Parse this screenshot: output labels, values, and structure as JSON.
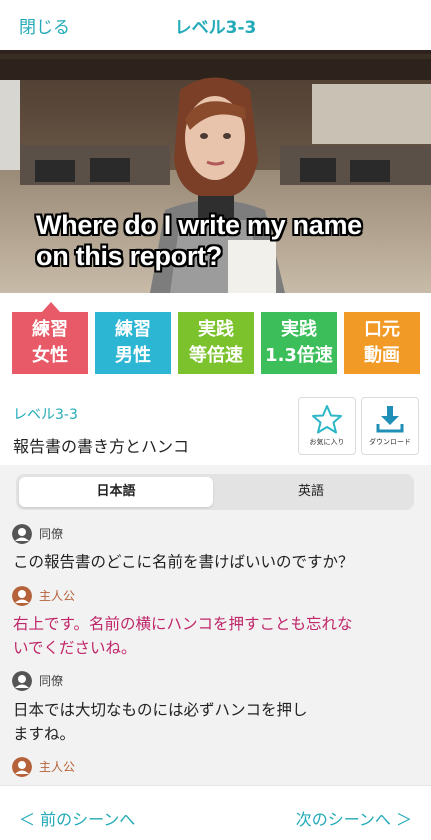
{
  "header": {
    "close_label": "閉じる",
    "title": "レベル3-3"
  },
  "video": {
    "subtitle_line1": "Where do I write my name",
    "subtitle_line2": "on this report?"
  },
  "modes": [
    {
      "label1": "練習",
      "label2": "女性",
      "color": "#e85a67",
      "selected": true
    },
    {
      "label1": "練習",
      "label2": "男性",
      "color": "#2db5d4",
      "selected": false
    },
    {
      "label1": "実践",
      "label2": "等倍速",
      "color": "#7cc22d",
      "selected": false
    },
    {
      "label1": "実践",
      "label2": "1.3倍速",
      "color": "#3cbf5b",
      "selected": false
    },
    {
      "label1": "口元",
      "label2": "動画",
      "color": "#f29a26",
      "selected": false
    }
  ],
  "lesson": {
    "level": "レベル3-3",
    "title": "報告書の書き方とハンコ"
  },
  "actions": {
    "favorite_label": "お気に入り",
    "download_label": "ダウンロード"
  },
  "tabs": {
    "japanese": "日本語",
    "english": "英語"
  },
  "conversation": [
    {
      "speaker": "同僚",
      "text": "この報告書のどこに名前を書けばいいのですか？"
    },
    {
      "speaker": "主人公",
      "text_line1": "右上です。名前の横にハンコを押すことも忘れな",
      "text_line2": "いでくださいね。"
    },
    {
      "speaker": "同僚",
      "text_line1": "日本では大切なものには必ずハンコを押し",
      "text_line2": "ますね。"
    },
    {
      "speaker": "主人公"
    }
  ],
  "footer": {
    "prev_label": "＜ 前のシーンへ",
    "next_label": "次のシーンへ ＞"
  },
  "colors": {
    "accent": "#22aab8",
    "protagonist": "#c0276a",
    "protagonist_name": "#b5623a"
  }
}
